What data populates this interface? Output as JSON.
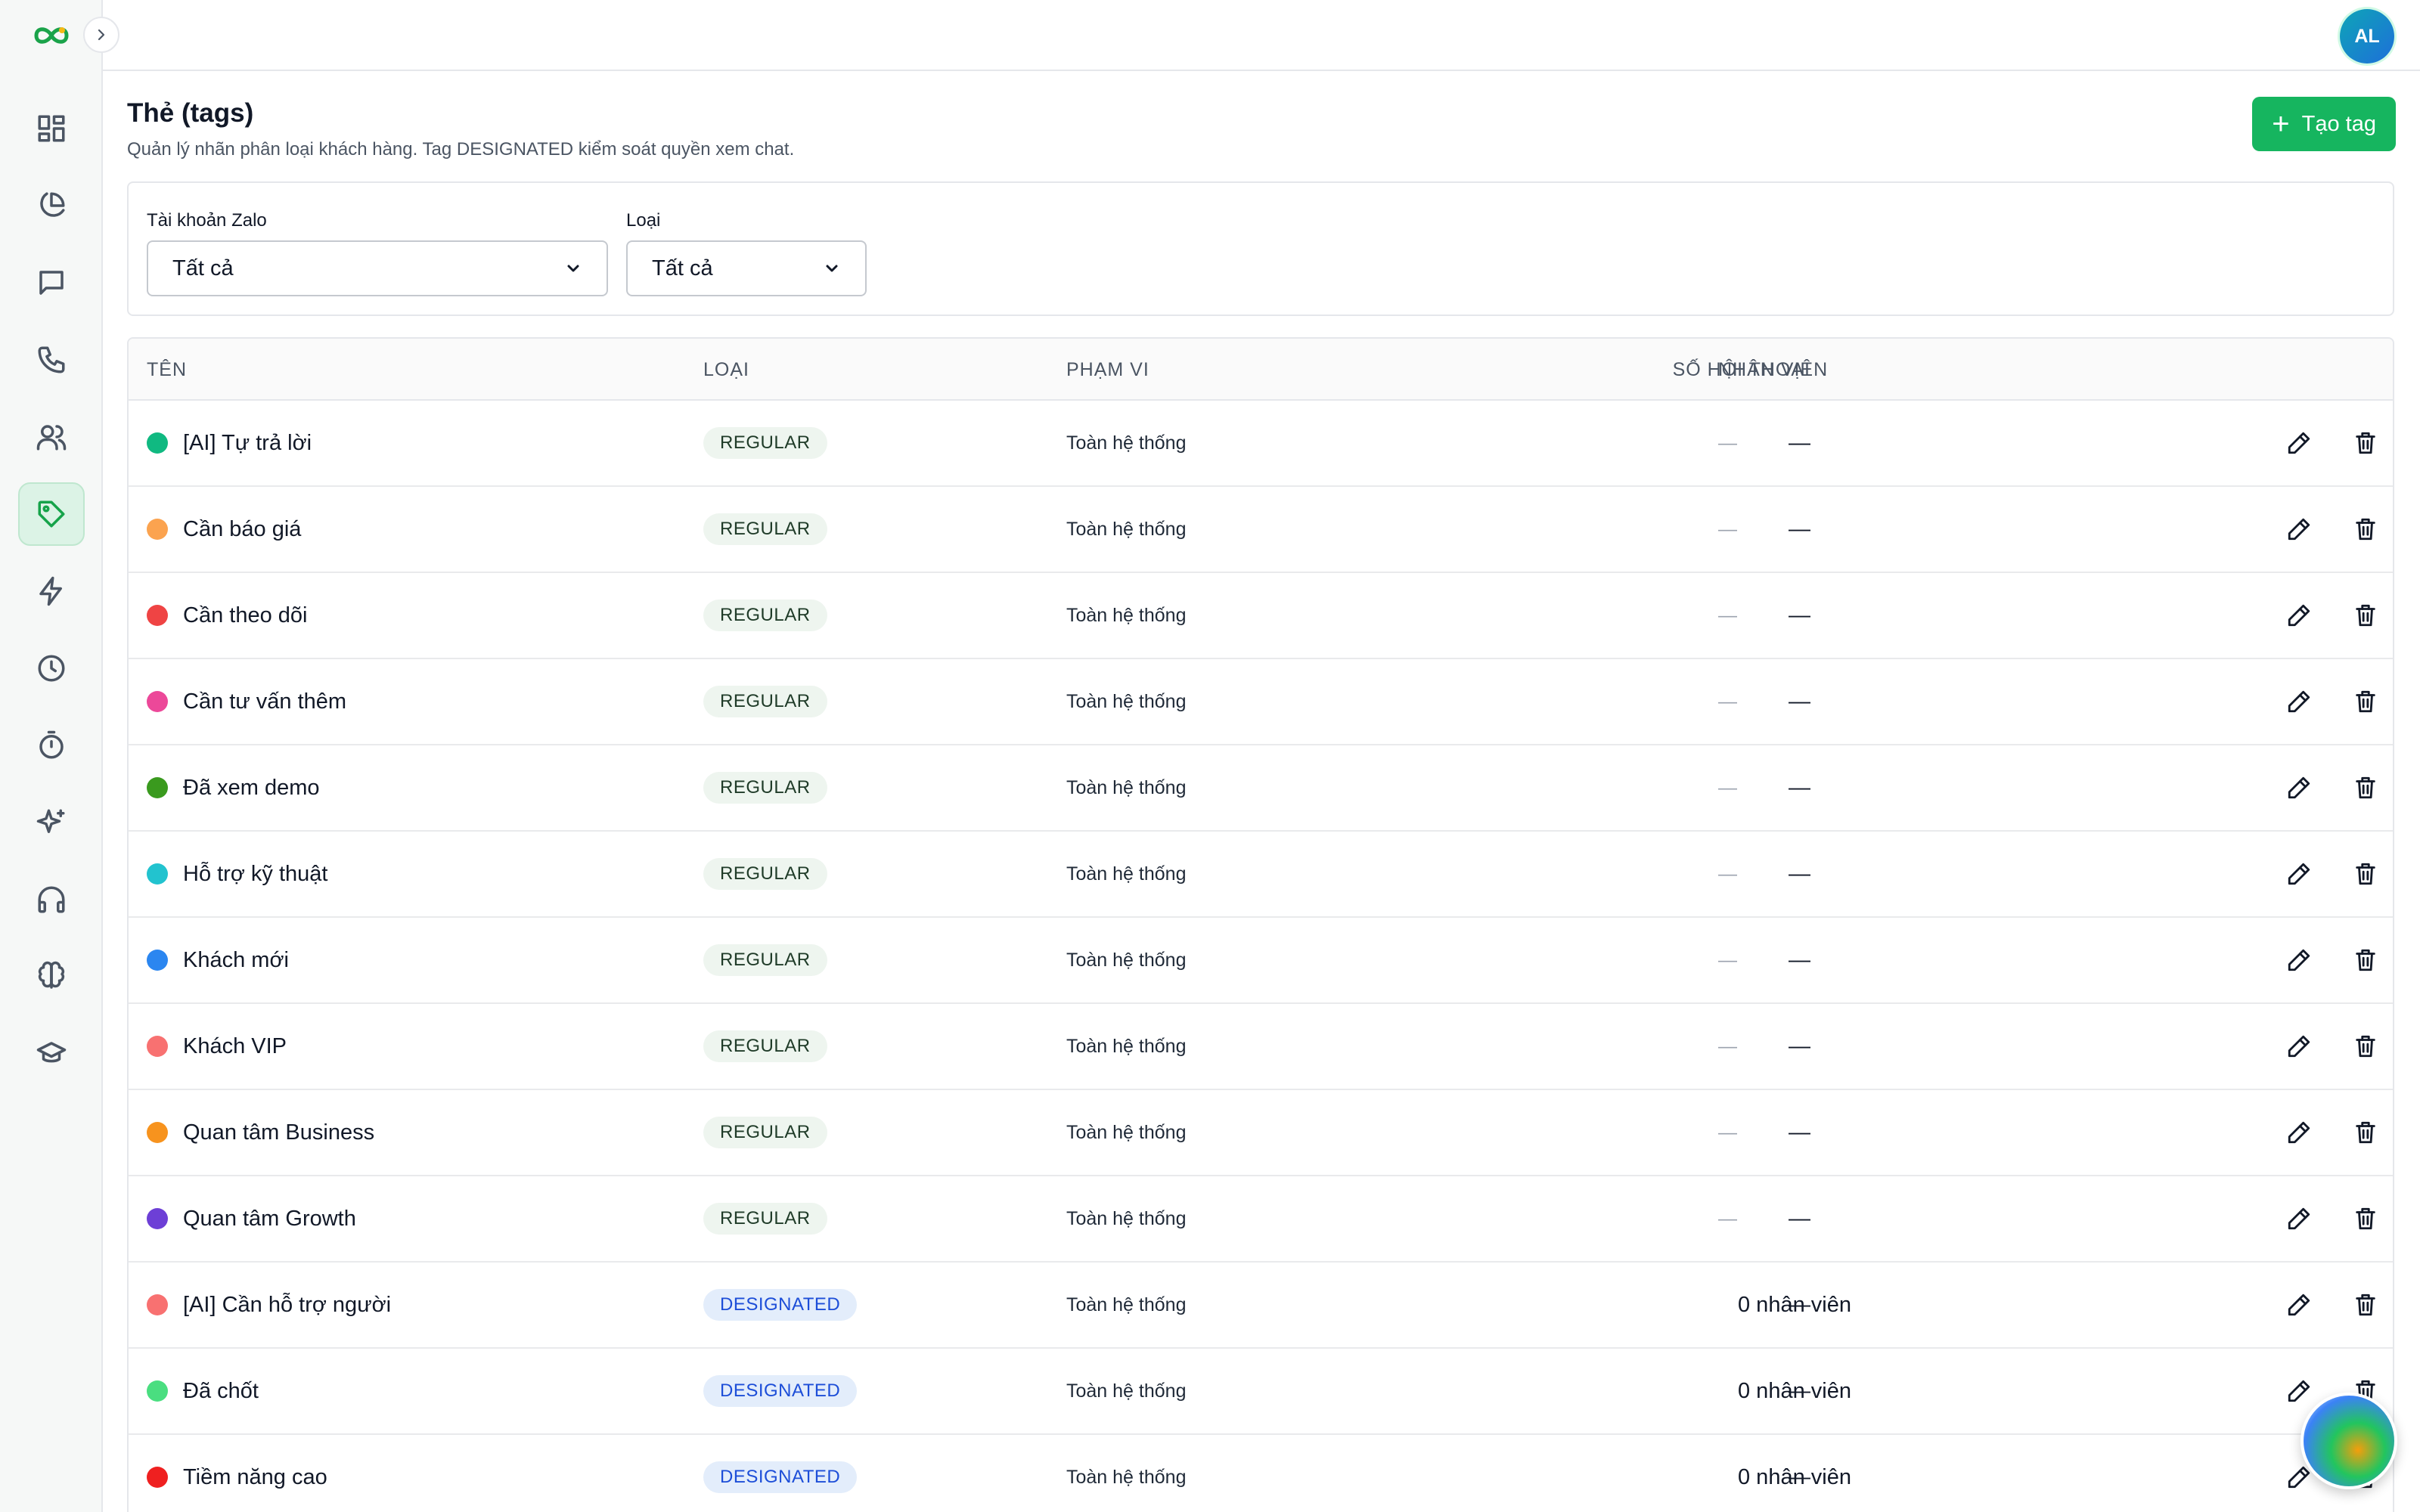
{
  "user": {
    "initials": "AL"
  },
  "sidebar": {
    "items": [
      {
        "name": "dashboard-icon",
        "active": false
      },
      {
        "name": "chart-pie-icon",
        "active": false
      },
      {
        "name": "message-icon",
        "active": false
      },
      {
        "name": "phone-icon",
        "active": false
      },
      {
        "name": "users-icon",
        "active": false
      },
      {
        "name": "tag-icon",
        "active": true
      },
      {
        "name": "lightning-icon",
        "active": false
      },
      {
        "name": "clock-icon",
        "active": false
      },
      {
        "name": "timer-icon",
        "active": false
      },
      {
        "name": "sparkles-icon",
        "active": false
      },
      {
        "name": "headphones-icon",
        "active": false
      },
      {
        "name": "brain-icon",
        "active": false
      },
      {
        "name": "graduation-cap-icon",
        "active": false
      }
    ]
  },
  "page": {
    "title": "Thẻ (tags)",
    "subtitle": "Quản lý nhãn phân loại khách hàng. Tag DESIGNATED kiểm soát quyền xem chat.",
    "create_label": "Tạo tag"
  },
  "filters": {
    "zalo_label": "Tài khoản Zalo",
    "zalo_value": "Tất cả",
    "type_label": "Loại",
    "type_value": "Tất cả"
  },
  "table": {
    "headers": {
      "name": "TÊN",
      "type": "LOẠI",
      "scope": "PHẠM VI",
      "conversations": "SỐ HỘI THOẠI",
      "staff": "NHÂN VIÊN"
    },
    "rows": [
      {
        "name": "[AI] Tự trả lời",
        "color": "#10b981",
        "type": "REGULAR",
        "scope": "Toàn hệ thống",
        "conversations": "—",
        "staff": "—"
      },
      {
        "name": "Cần báo giá",
        "color": "#fba34f",
        "type": "REGULAR",
        "scope": "Toàn hệ thống",
        "conversations": "—",
        "staff": "—"
      },
      {
        "name": "Cần theo dõi",
        "color": "#ef4444",
        "type": "REGULAR",
        "scope": "Toàn hệ thống",
        "conversations": "—",
        "staff": "—"
      },
      {
        "name": "Cần tư vấn thêm",
        "color": "#ec4899",
        "type": "REGULAR",
        "scope": "Toàn hệ thống",
        "conversations": "—",
        "staff": "—"
      },
      {
        "name": "Đã xem demo",
        "color": "#3a9a1e",
        "type": "REGULAR",
        "scope": "Toàn hệ thống",
        "conversations": "—",
        "staff": "—"
      },
      {
        "name": "Hỗ trợ kỹ thuật",
        "color": "#22c3cf",
        "type": "REGULAR",
        "scope": "Toàn hệ thống",
        "conversations": "—",
        "staff": "—"
      },
      {
        "name": "Khách mới",
        "color": "#2b86f0",
        "type": "REGULAR",
        "scope": "Toàn hệ thống",
        "conversations": "—",
        "staff": "—"
      },
      {
        "name": "Khách VIP",
        "color": "#f87171",
        "type": "REGULAR",
        "scope": "Toàn hệ thống",
        "conversations": "—",
        "staff": "—"
      },
      {
        "name": "Quan tâm Business",
        "color": "#f7931e",
        "type": "REGULAR",
        "scope": "Toàn hệ thống",
        "conversations": "—",
        "staff": "—"
      },
      {
        "name": "Quan tâm Growth",
        "color": "#6d3fd6",
        "type": "REGULAR",
        "scope": "Toàn hệ thống",
        "conversations": "—",
        "staff": "—"
      },
      {
        "name": "[AI] Cần hỗ trợ người",
        "color": "#f87171",
        "type": "DESIGNATED",
        "scope": "Toàn hệ thống",
        "conversations": "—",
        "staff": "0 nhân viên"
      },
      {
        "name": "Đã chốt",
        "color": "#4ade80",
        "type": "DESIGNATED",
        "scope": "Toàn hệ thống",
        "conversations": "—",
        "staff": "0 nhân viên"
      },
      {
        "name": "Tiềm năng cao",
        "color": "#ef2020",
        "type": "DESIGNATED",
        "scope": "Toàn hệ thống",
        "conversations": "—",
        "staff": "0 nhân viên"
      }
    ]
  }
}
